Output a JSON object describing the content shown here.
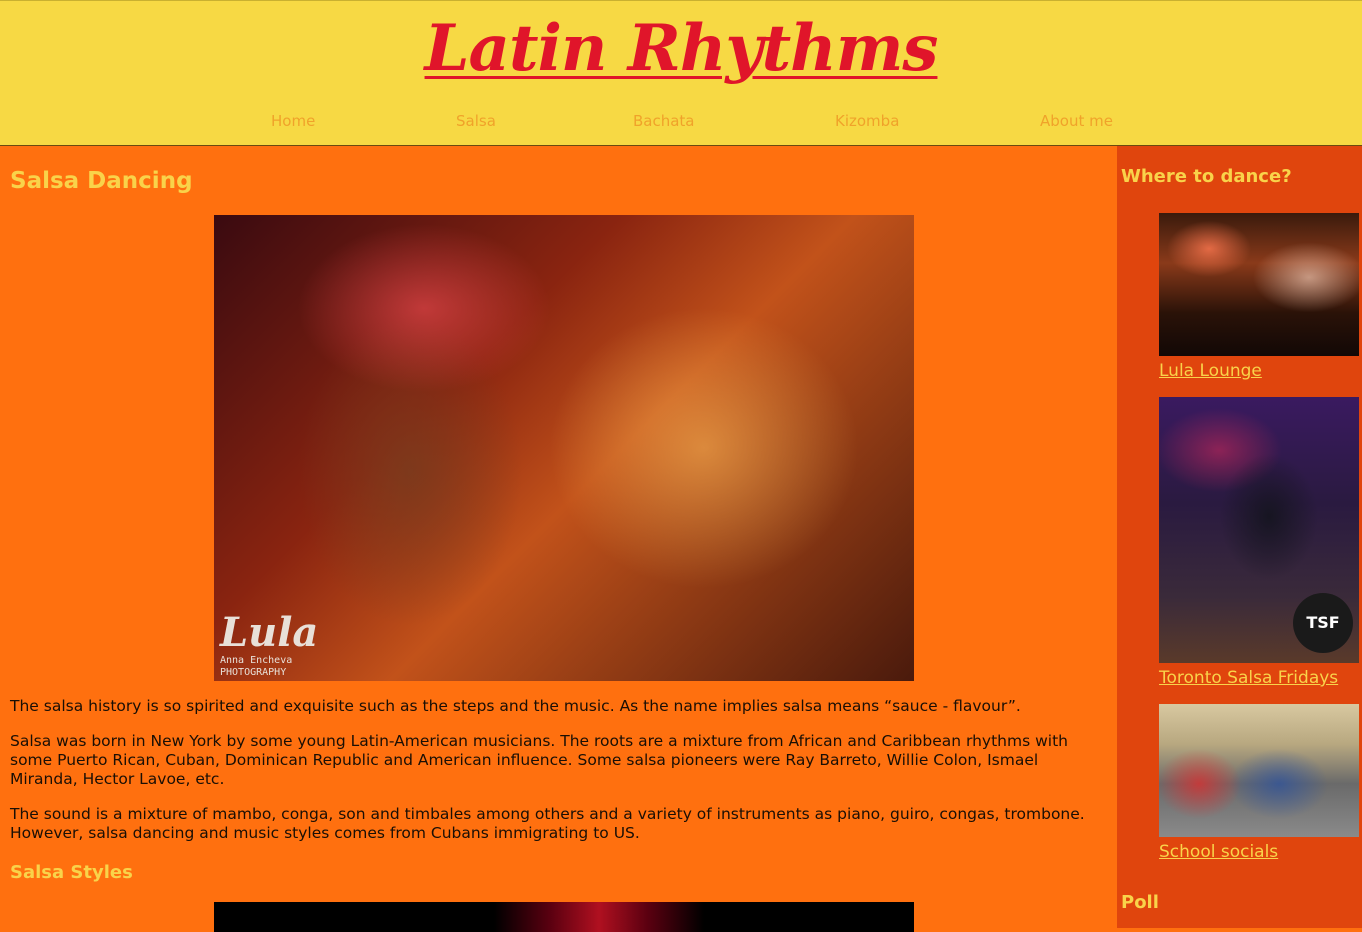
{
  "header": {
    "site_title": "Latin Rhythms",
    "nav": [
      "Home",
      "Salsa",
      "Bachata",
      "Kizomba",
      "About me"
    ]
  },
  "main": {
    "heading": "Salsa Dancing",
    "hero_watermark": {
      "logo": "Lula",
      "credit_line1": "Anna Encheva",
      "credit_line2": "PHOTOGRAPHY"
    },
    "paragraphs": [
      "The salsa history is so spirited and exquisite such as the steps and the music. As the name implies salsa means “sauce - flavour”.",
      "Salsa was born in New York by some young Latin-American musicians. The roots are a mixture from African and Caribbean rhythms with some Puerto Rican, Cuban, Dominican Republic and American influence. Some salsa pioneers were Ray Barreto, Willie Colon, Ismael Miranda, Hector Lavoe, etc.",
      "The sound is a mixture of mambo, conga, son and timbales among others and a variety of instruments as piano, guiro, congas, trombone. However, salsa dancing and music styles comes from Cubans immigrating to US."
    ],
    "subheading": "Salsa Styles"
  },
  "aside": {
    "heading": "Where to dance?",
    "venues": [
      {
        "label": "Lula Lounge"
      },
      {
        "label": "Toronto Salsa Fridays",
        "badge": "TSF"
      },
      {
        "label": "School socials"
      }
    ],
    "poll_heading": "Poll"
  },
  "colors": {
    "header_bg": "#f7d944",
    "title_red": "#e0152a",
    "main_bg": "#ff700f",
    "aside_bg": "#e0450d",
    "heading_yellow": "#f9d34a"
  }
}
